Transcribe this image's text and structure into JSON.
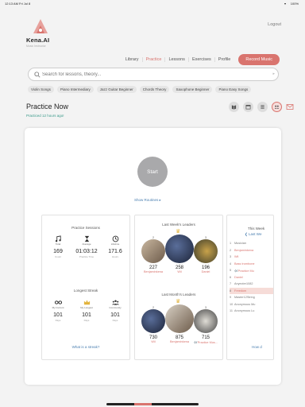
{
  "status": {
    "time": "12:13 AM  Fri Jul 8",
    "battery": "100%",
    "wifi": "▾"
  },
  "brand": {
    "name": "Kena.AI",
    "tagline": "Music Instructor"
  },
  "header": {
    "logout": "Logout"
  },
  "nav": {
    "items": [
      "Library",
      "Practice",
      "Lessons",
      "Exercises",
      "Profile"
    ],
    "active": "Practice",
    "record": "Record Music"
  },
  "search": {
    "placeholder": "Search for lessons, theory..."
  },
  "chips": [
    "Violin Songs",
    "Piano Intermediary",
    "Jazz Guitar Beginner",
    "Chords Theory",
    "Saxophone Beginner",
    "Piano Easy Songs"
  ],
  "page": {
    "title": "Practice Now",
    "subtitle": "Practiced 12 hours ago!"
  },
  "toolbar": {
    "icons": [
      "book-icon",
      "calendar-icon",
      "list-icon",
      "group-icon",
      "mail-icon"
    ],
    "active": "group-icon"
  },
  "practice": {
    "start": "Start",
    "show_routines": "Show Routines ▸"
  },
  "sessions": {
    "title": "Practice Sessions",
    "stats": [
      {
        "icon": "music-note-icon",
        "label": "Total",
        "value": "169",
        "unit": "Count"
      },
      {
        "icon": "hourglass-icon",
        "label": "Average",
        "value": "01:03:12",
        "unit": "Practice Time"
      },
      {
        "icon": "clock-icon",
        "label": "Lifetime",
        "value": "171.6",
        "unit": "Hours"
      }
    ],
    "streak_title": "Longest Streak",
    "streaks": [
      {
        "icon": "infinity-icon",
        "label": "My Current",
        "value": "101",
        "unit": "Days"
      },
      {
        "icon": "crown-icon",
        "label": "My Longest",
        "value": "101",
        "unit": "Days"
      },
      {
        "icon": "community-icon",
        "label": "Community",
        "value": "101",
        "unit": "Days"
      }
    ],
    "link": "What is a streak?"
  },
  "leaders": {
    "week_title": "Last Week's Leaders",
    "week": [
      {
        "rank": "2",
        "score": "227",
        "name": "Benjaminkena"
      },
      {
        "rank": "1",
        "score": "258",
        "name": "Wil"
      },
      {
        "rank": "3",
        "score": "196",
        "name": "Daniel"
      }
    ],
    "month_title": "Last Month's Leaders",
    "month": [
      {
        "rank": "2",
        "score": "730",
        "name": "Wil"
      },
      {
        "rank": "1",
        "score": "875",
        "name": "Benjaminkena"
      },
      {
        "rank": "3",
        "score": "715",
        "name": "🎶Practice Mus..."
      }
    ]
  },
  "ranking": {
    "title": "This Week",
    "subtitle": "❮ Last We",
    "rows": [
      {
        "n": "1",
        "name": "Musician"
      },
      {
        "n": "2",
        "name": "Benjaminkena"
      },
      {
        "n": "3",
        "name": "Wil"
      },
      {
        "n": "4",
        "name": "Bass trombone"
      },
      {
        "n": "5",
        "name": "🎶Practice Mu"
      },
      {
        "n": "6",
        "name": "Daniel"
      },
      {
        "n": "7",
        "name": "Anyecter1082"
      },
      {
        "n": "8",
        "name": "Freedom"
      },
      {
        "n": "9",
        "name": "Master12String"
      },
      {
        "n": "10",
        "name": "Anonymous Mu"
      },
      {
        "n": "11",
        "name": "Anonymous Lu"
      }
    ],
    "link": "How d"
  },
  "colors": {
    "accent": "#d9746e",
    "teal": "#3a9a8a",
    "link": "#4a7fb0"
  }
}
